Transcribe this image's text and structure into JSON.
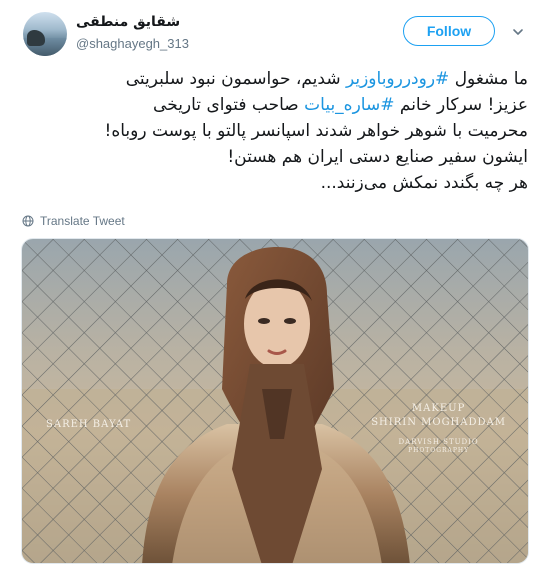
{
  "author": {
    "name": "شقایق منطقی",
    "handle": "@shaghayegh_313"
  },
  "actions": {
    "follow_label": "Follow"
  },
  "tweet": {
    "lines": [
      [
        {
          "text": "ما مشغول ",
          "type": "text"
        },
        {
          "text": "#رودرروباوزیر",
          "type": "hashtag"
        },
        {
          "text": " شدیم، حواسمون نبود سلبریتی",
          "type": "text"
        }
      ],
      [
        {
          "text": "عزیز! سرکار خانم ",
          "type": "text"
        },
        {
          "text": "#ساره_بیات",
          "type": "hashtag"
        },
        {
          "text": " صاحب فتوای تاریخی",
          "type": "text"
        }
      ],
      [
        {
          "text": "محرمیت با شوهر خواهر شدند اسپانسر پالتو با پوست روباه!",
          "type": "text"
        }
      ],
      [
        {
          "text": "ایشون سفیر صنایع دستی ایران هم هستن!",
          "type": "text"
        }
      ],
      [
        {
          "text": "هر چه بگندد نمکش می‌زنند...",
          "type": "text"
        }
      ]
    ],
    "translate_label": "Translate Tweet"
  },
  "media": {
    "caption_left": "SAREH BAYAT",
    "caption_right_1": "MAKEUP",
    "caption_right_2": "SHIRIN MOGHADDAM",
    "caption_right_3": "DARVISH STUDIO",
    "caption_right_4": "PHOTOGRAPHY"
  },
  "colors": {
    "accent": "#1da1f2",
    "hashtag": "#1b95e0",
    "muted": "#657786",
    "text": "#14171a"
  },
  "icons": {
    "more": "chevron-down-icon",
    "translate": "globe-icon"
  }
}
